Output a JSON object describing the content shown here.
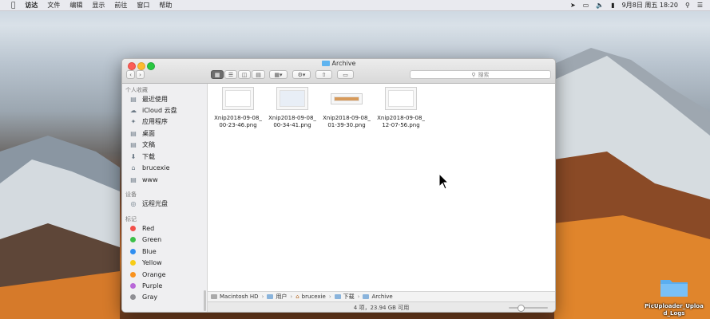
{
  "menubar": {
    "apple": "",
    "items": [
      "访达",
      "文件",
      "编辑",
      "显示",
      "前往",
      "窗口",
      "帮助"
    ],
    "clock": "9月8日 周五 18:20"
  },
  "window": {
    "title": "Archive",
    "search_placeholder": "搜索",
    "view_mode": "icon"
  },
  "sidebar": {
    "favorites_heading": "个人收藏",
    "favorites": [
      {
        "label": "最近使用",
        "icon": "recents-icon"
      },
      {
        "label": "iCloud 云盘",
        "icon": "icloud-icon"
      },
      {
        "label": "应用程序",
        "icon": "applications-icon"
      },
      {
        "label": "桌面",
        "icon": "desktop-icon"
      },
      {
        "label": "文稿",
        "icon": "documents-icon"
      },
      {
        "label": "下载",
        "icon": "downloads-icon"
      },
      {
        "label": "brucexie",
        "icon": "home-icon"
      },
      {
        "label": "www",
        "icon": "folder-icon"
      }
    ],
    "devices_heading": "设备",
    "devices": [
      {
        "label": "远程光盘",
        "icon": "disc-icon"
      }
    ],
    "tags_heading": "标记",
    "tags": [
      {
        "label": "Red",
        "color": "#f2504a"
      },
      {
        "label": "Green",
        "color": "#3cc048"
      },
      {
        "label": "Blue",
        "color": "#2f8ef0"
      },
      {
        "label": "Yellow",
        "color": "#f7cc16"
      },
      {
        "label": "Orange",
        "color": "#f9921e"
      },
      {
        "label": "Purple",
        "color": "#b867d8"
      },
      {
        "label": "Gray",
        "color": "#8e8e93"
      }
    ]
  },
  "files": [
    {
      "line1": "Xnip2018-09-08_",
      "line2": "00-23-46.png"
    },
    {
      "line1": "Xnip2018-09-08_",
      "line2": "00-34-41.png"
    },
    {
      "line1": "Xnip2018-09-08_",
      "line2": "01-39-30.png"
    },
    {
      "line1": "Xnip2018-09-08_",
      "line2": "12-07-56.png"
    }
  ],
  "pathbar": [
    "Macintosh HD",
    "用户",
    "brucexie",
    "下载",
    "Archive"
  ],
  "status": {
    "text": "4 项，23.94 GB 可用",
    "zoom_level": 0.25
  },
  "desktop": {
    "folder_label_1": "PicUploader_Uploa",
    "folder_label_2": "d_Logs"
  }
}
